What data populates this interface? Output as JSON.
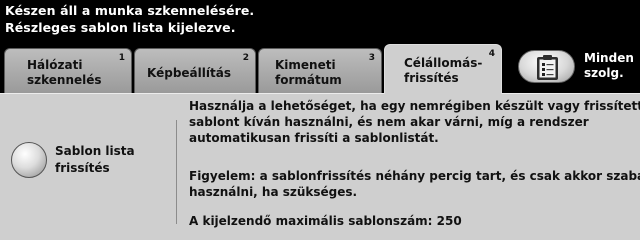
{
  "status": {
    "line1": "Készen áll a munka szkennelésére.",
    "line2": "Részleges sablon lista kijelezve."
  },
  "tabs": [
    {
      "line1": "Hálózati",
      "line2": "szkennelés",
      "number": "1"
    },
    {
      "line1": "Képbeállítás",
      "line2": "",
      "number": "2"
    },
    {
      "line1": "Kimeneti",
      "line2": "formátum",
      "number": "3"
    },
    {
      "line1": "Célállomás-",
      "line2": "frissítés",
      "number": "4"
    }
  ],
  "all_services": {
    "line1": "Minden",
    "line2": "szolg.",
    "icon": "clipboard-icon"
  },
  "refresh": {
    "line1": "Sablon lista",
    "line2": "frissítés"
  },
  "info": {
    "para1": "Használja a lehetőséget, ha egy nemrégiben készült vagy frissített\nsablont kíván használni, és nem akar várni, míg a rendszer\nautomatikusan frissíti a sablonlistát.",
    "para2": "Figyelem: a sablonfrissítés néhány percig tart, és csak akkor szabad\nhasználni, ha szükséges.",
    "para3": "A kijelzendő maximális sablonszám: 250"
  },
  "colors": {
    "screen": "#000000",
    "panel": "#cfcfcf",
    "tab": "#a8a8a8",
    "text": "#111111"
  }
}
